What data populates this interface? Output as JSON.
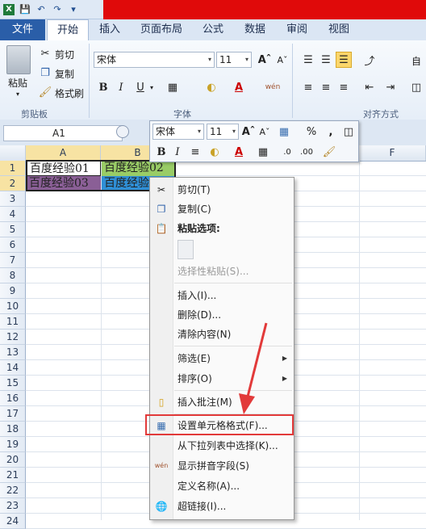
{
  "qat": {
    "save_icon": "save-icon",
    "undo_icon": "undo-icon",
    "redo_icon": "redo-icon",
    "customize_icon": "customize-icon"
  },
  "tabs": [
    "文件",
    "开始",
    "插入",
    "页面布局",
    "公式",
    "数据",
    "审阅",
    "视图"
  ],
  "ribbon": {
    "clipboard": {
      "paste": "粘贴",
      "cut": "剪切",
      "copy": "复制",
      "format_painter": "格式刷",
      "group_label": "剪贴板"
    },
    "font": {
      "font_name": "宋体",
      "font_size": "11",
      "bold": "B",
      "italic": "I",
      "underline": "U",
      "group_label": "字体"
    },
    "alignment": {
      "group_label": "对齐方式",
      "wrap_char": "自"
    }
  },
  "formula_bar": {
    "name_box": "A1"
  },
  "sheet": {
    "columns": [
      "A",
      "B",
      "F"
    ],
    "rows": [
      "1",
      "2",
      "3",
      "4",
      "5",
      "6",
      "7",
      "8",
      "9",
      "10",
      "11",
      "12",
      "13",
      "14",
      "15",
      "16",
      "17",
      "18",
      "19",
      "20",
      "21",
      "22",
      "23",
      "24"
    ],
    "cells": {
      "A1": "百度经验01",
      "B1": "百度经验02",
      "A2": "百度经验03",
      "B2": "百度经验04"
    },
    "colors": {
      "A1": "#ffffff",
      "B1": "#99cc66",
      "A2": "#8a5f96",
      "B2": "#2f8fd6"
    }
  },
  "mini_toolbar": {
    "font_name": "宋体",
    "font_size": "11",
    "percent": "%",
    "comma": ",",
    "bold": "B",
    "italic": "I"
  },
  "context_menu": {
    "items": [
      {
        "label": "剪切(T)",
        "icon": "scissors-icon"
      },
      {
        "label": "复制(C)",
        "icon": "copy-icon"
      },
      {
        "label": "粘贴选项:",
        "icon": "clipboard-icon"
      },
      {
        "label": "选择性粘贴(S)...",
        "icon": ""
      },
      {
        "label": "插入(I)...",
        "icon": ""
      },
      {
        "label": "删除(D)...",
        "icon": ""
      },
      {
        "label": "清除内容(N)",
        "icon": ""
      },
      {
        "label": "筛选(E)",
        "icon": ""
      },
      {
        "label": "排序(O)",
        "icon": ""
      },
      {
        "label": "插入批注(M)",
        "icon": "comment-icon"
      },
      {
        "label": "设置单元格格式(F)...",
        "icon": "format-cells-icon"
      },
      {
        "label": "从下拉列表中选择(K)...",
        "icon": ""
      },
      {
        "label": "显示拼音字段(S)",
        "icon": "phonetic-icon"
      },
      {
        "label": "定义名称(A)...",
        "icon": ""
      },
      {
        "label": "超链接(I)...",
        "icon": "hyperlink-icon"
      }
    ]
  },
  "annotation": {
    "highlight_color": "#e23a3a"
  }
}
